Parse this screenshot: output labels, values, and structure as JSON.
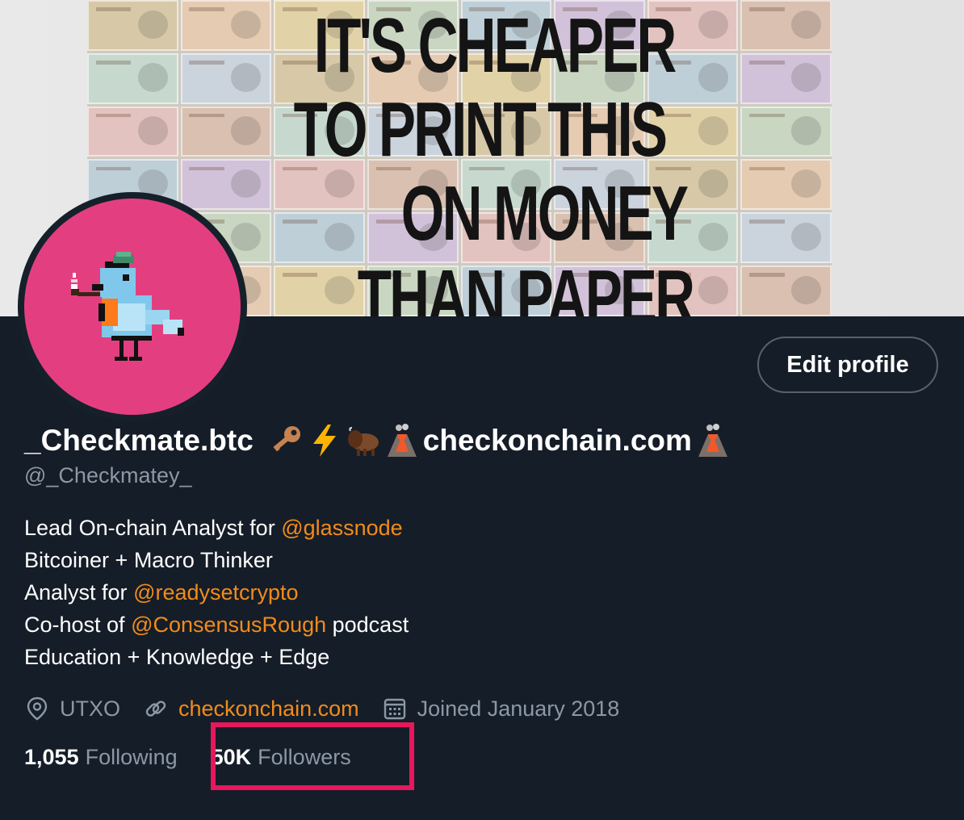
{
  "banner": {
    "lines": [
      "IT'S CHEAPER",
      "TO PRINT THIS",
      "ON MONEY",
      "THAN PAPER"
    ]
  },
  "profile": {
    "display_name": "_Checkmate.btc",
    "name_suffix": "checkonchain.com",
    "name_emojis": [
      "key-icon",
      "lightning-icon",
      "bison-icon",
      "volcano-icon"
    ],
    "handle": "@_Checkmatey_",
    "edit_button_label": "Edit profile"
  },
  "bio": {
    "line1_text": "Lead On-chain Analyst for ",
    "line1_mention": "@glassnode",
    "line2_text": "Bitcoiner + Macro Thinker",
    "line3_text": "Analyst for ",
    "line3_mention": "@readysetcrypto",
    "line4_text": "Co-host of ",
    "line4_mention": "@ConsensusRough",
    "line4_suffix": " podcast",
    "line5_text": "Education + Knowledge + Edge"
  },
  "meta": {
    "location": "UTXO",
    "website": "checkonchain.com",
    "joined": "Joined January 2018"
  },
  "stats": {
    "following_count": "1,055",
    "following_label": "Following",
    "followers_count": "50K",
    "followers_label": "Followers"
  },
  "colors": {
    "background": "#151d28",
    "accent": "#f28b1a",
    "avatar_bg": "#e33f80",
    "highlight": "#e8175d",
    "muted_text": "#8b98a5"
  }
}
